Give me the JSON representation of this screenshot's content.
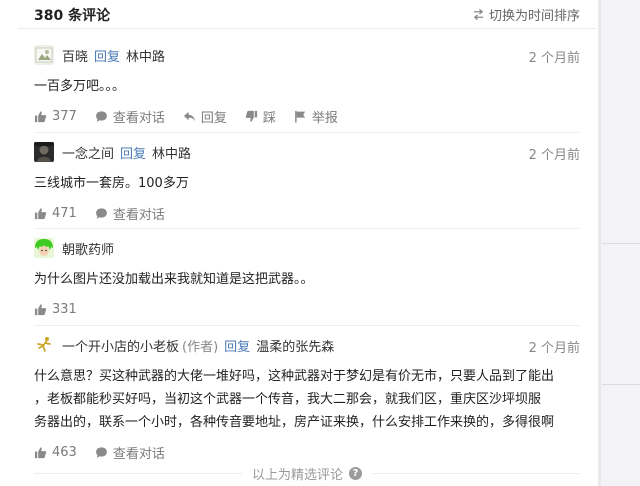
{
  "header": {
    "count_label": "380 条评论",
    "sort_label": "切换为时间排序"
  },
  "comments": [
    {
      "username": "百晓",
      "reply_word": "回复",
      "reply_target": "林中路",
      "time": "2 个月前",
      "text": "一百多万吧。。。",
      "likes": "377",
      "view_conversation": "查看对话",
      "reply": "回复",
      "dislike": "踩",
      "report": "举报"
    },
    {
      "username": "一念之间",
      "reply_word": "回复",
      "reply_target": "林中路",
      "time": "2 个月前",
      "text": "三线城市一套房。100多万",
      "likes": "471",
      "view_conversation": "查看对话"
    },
    {
      "username": "朝歌药师",
      "text": "为什么图片还没加载出来我就知道是这把武器。。",
      "likes": "331"
    },
    {
      "username": "一个开小店的小老板",
      "author_tag": "(作者)",
      "reply_word": "回复",
      "reply_target": "温柔的张先森",
      "time": "2 个月前",
      "text_lines": [
        "什么意思？买这种武器的大佬一堆好吗，这种武器对于梦幻是有价无市，只要人品到了能出",
        "，老板都能秒买好吗，当初这个武器一个传音，我大二那会，就我们区，重庆区沙坪坝服",
        "务器出的，联系一个小时，各种传音要地址，房产证来换，什么安排工作来换的，多得很啊"
      ],
      "likes": "463",
      "view_conversation": "查看对话"
    }
  ],
  "footer": {
    "featured_label": "以上为精选评论",
    "help_symbol": "?"
  },
  "colors": {
    "link_blue": "#4a7bb5",
    "muted": "#7b7b7b"
  }
}
